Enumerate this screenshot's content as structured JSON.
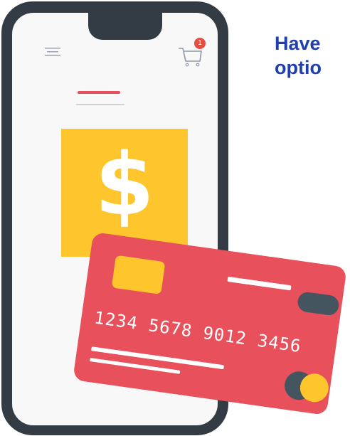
{
  "headline": {
    "line1": "Have",
    "line2": "optio"
  },
  "phone": {
    "cart_badge": "1",
    "product_symbol": "$"
  },
  "card": {
    "number": "1234 5678 9012 3456"
  },
  "icons": {
    "menu": "hamburger-menu-icon",
    "cart": "shopping-cart-icon",
    "brand": "card-brand-logo-icon"
  },
  "colors": {
    "headline": "#1f3fae",
    "phone_frame": "#333c45",
    "screen": "#f8f8f9",
    "accent_red": "#e8505b",
    "accent_yellow": "#ffc52c",
    "card_dark": "#455560",
    "badge": "#e74c3c"
  }
}
